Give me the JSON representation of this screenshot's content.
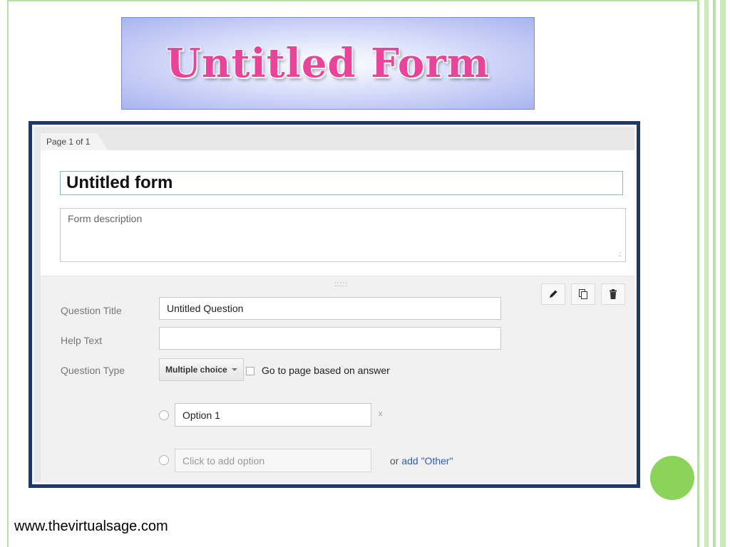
{
  "slide": {
    "title": "Untitled Form",
    "footer_url": "www.thevirtualsage.com",
    "colors": {
      "title_pink": "#e8449a",
      "frame_navy": "#1f3766",
      "accent_green": "#8bd35a"
    }
  },
  "form": {
    "page_indicator": "Page 1 of 1",
    "title_value": "Untitled form",
    "description_placeholder": "Form description",
    "question": {
      "title_label": "Question Title",
      "title_value": "Untitled Question",
      "help_label": "Help Text",
      "help_value": "",
      "type_label": "Question Type",
      "type_value": "Multiple choice",
      "goto_page_label": "Go to page based on answer",
      "option1_value": "Option 1",
      "option_remove": "x",
      "add_option_placeholder": "Click to add option",
      "or_text": "or",
      "add_other_link": "add \"Other\""
    },
    "toolbar_icons": [
      "edit-icon",
      "duplicate-icon",
      "delete-icon"
    ]
  }
}
